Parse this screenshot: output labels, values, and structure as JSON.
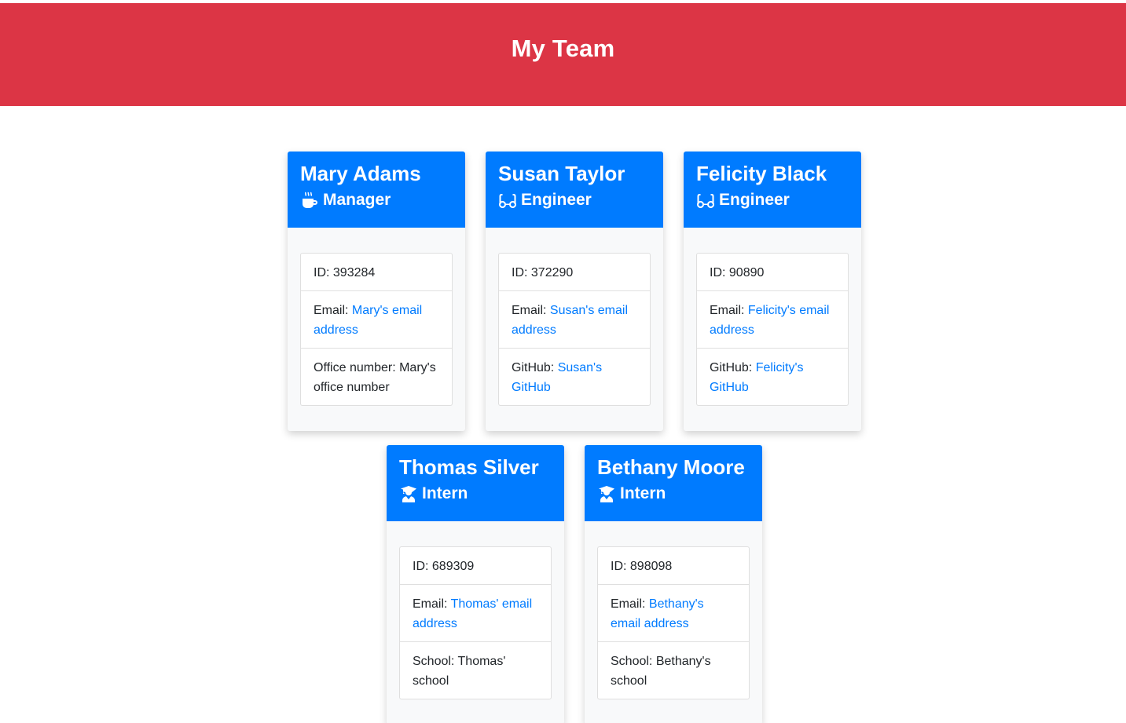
{
  "page": {
    "title": "My Team"
  },
  "colors": {
    "header_bg": "#dc3545",
    "card_header_bg": "#007bff",
    "link": "#007bff"
  },
  "cards": [
    {
      "name": "Mary Adams",
      "role": "Manager",
      "role_icon": "coffee-icon",
      "id_label": "ID: 393284",
      "email_prefix": "Email: ",
      "email_link": "Mary's email address",
      "extra_prefix": "Office number: Mary's office number",
      "extra_link": ""
    },
    {
      "name": "Susan Taylor",
      "role": "Engineer",
      "role_icon": "glasses-icon",
      "id_label": "ID: 372290",
      "email_prefix": "Email: ",
      "email_link": "Susan's email address",
      "extra_prefix": "GitHub: ",
      "extra_link": "Susan's GitHub"
    },
    {
      "name": "Felicity Black",
      "role": "Engineer",
      "role_icon": "glasses-icon",
      "id_label": "ID: 90890",
      "email_prefix": "Email: ",
      "email_link": "Felicity's email address",
      "extra_prefix": "GitHub: ",
      "extra_link": "Felicity's GitHub"
    },
    {
      "name": "Thomas Silver",
      "role": "Intern",
      "role_icon": "graduate-icon",
      "id_label": "ID: 689309",
      "email_prefix": "Email: ",
      "email_link": "Thomas' email address",
      "extra_prefix": "School: Thomas' school",
      "extra_link": ""
    },
    {
      "name": "Bethany Moore",
      "role": "Intern",
      "role_icon": "graduate-icon",
      "id_label": "ID: 898098",
      "email_prefix": "Email: ",
      "email_link": "Bethany's email address",
      "extra_prefix": "School: Bethany's school",
      "extra_link": ""
    }
  ]
}
